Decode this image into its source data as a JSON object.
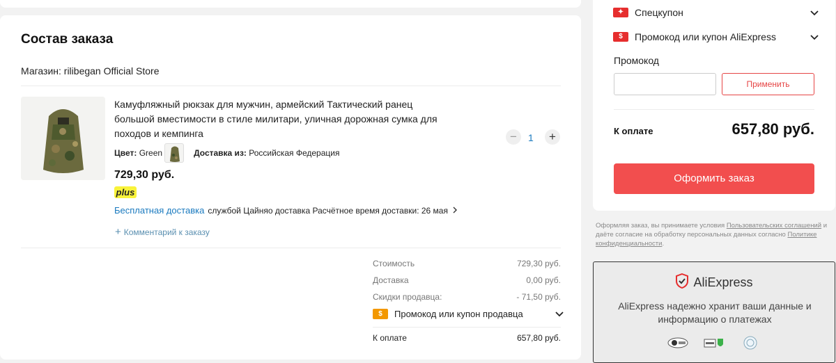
{
  "order": {
    "title": "Состав заказа",
    "store": "Магазин: rilibegan Official Store",
    "product": {
      "name": "Камуфляжный рюкзак для мужчин, армейский Тактический ранец большой вместимости в стиле милитари, уличная дорожная сумка для походов и кемпинга",
      "color_label": "Цвет:",
      "color_value": "Green",
      "delivery_from_label": "Доставка из:",
      "delivery_from_value": "Российская Федерация",
      "price": "729,30 руб.",
      "plus_badge": "plus",
      "free_shipping": "Бесплатная доставка",
      "carrier": "службой Цайняо доставка",
      "eta": "Расчётное время доставки: 26 мая",
      "comment": "Комментарий к заказу",
      "quantity": "1"
    },
    "summary": {
      "cost_label": "Стоимость",
      "cost_value": "729,30 руб.",
      "delivery_label": "Доставка",
      "delivery_value": "0,00 руб.",
      "discount_label": "Скидки продавца:",
      "discount_value": "- 71,50 руб.",
      "seller_coupon": "Промокод или купон продавца",
      "total_label": "К оплате",
      "total_value": "657,80 руб."
    }
  },
  "sidebar": {
    "special_coupon": "Спецкупон",
    "ae_coupon": "Промокод или купон AliExpress",
    "promo_label": "Промокод",
    "promo_placeholder": "",
    "apply_button": "Применить",
    "pay_label": "К оплате",
    "pay_amount": "657,80 руб.",
    "order_button": "Оформить заказ",
    "legal_prefix": "Оформляя заказ, вы принимаете условия",
    "legal_link1": "Пользовательских соглашений",
    "legal_middle": "и даёте согласие на обработку персональных данных согласно",
    "legal_link2": "Политике конфиденциальности",
    "legal_end": ".",
    "trust_brand": "AliExpress",
    "trust_text": "AliExpress надежно хранит ваши данные и информацию о платежах"
  },
  "colors": {
    "accent": "#f24e4e",
    "link": "#1a7abf",
    "plus": "#f9f33a",
    "coupon_orange": "#f39800"
  }
}
